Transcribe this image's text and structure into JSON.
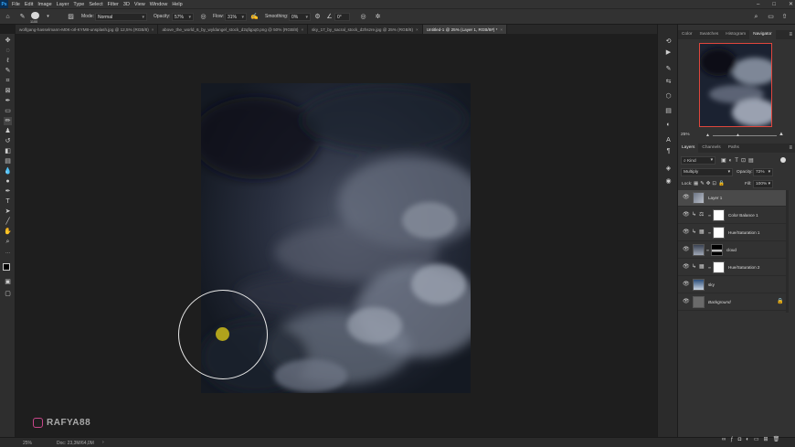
{
  "menu": {
    "app_icon": "Ps",
    "items": [
      "File",
      "Edit",
      "Image",
      "Layer",
      "Type",
      "Select",
      "Filter",
      "3D",
      "View",
      "Window",
      "Help"
    ]
  },
  "options": {
    "brush_size": "1100",
    "mode_label": "Mode:",
    "mode_value": "Normal",
    "opacity_label": "Opacity:",
    "opacity_value": "57%",
    "flow_label": "Flow:",
    "flow_value": "31%",
    "smoothing_label": "Smoothing:",
    "smoothing_value": "0%",
    "angle_value": "0°"
  },
  "tabs": [
    {
      "label": "wolfgang-hasselmann-M0K-oIl-KYM8-unsplash.jpg @ 12,5% (RGB/8)"
    },
    {
      "label": "above_the_world_6_by_wyldangel_stock_d2qfqpq0.png @ 50% (RGB/8)"
    },
    {
      "label": "sky_17_by_sacral_stock_d2hszre.jpg @ 25% (RGB/8)"
    },
    {
      "label": "Untitled-1 @ 25% (Layer 1, RGB/8#) *"
    }
  ],
  "active_tab_index": 3,
  "watermark": "RAFYA88",
  "status": {
    "zoom": "25%",
    "doc": "Doc: 23,3M/64,0M"
  },
  "navigator": {
    "tabs": [
      "Color",
      "Swatches",
      "Histogram",
      "Navigator"
    ],
    "active": "Navigator",
    "zoom": "25%"
  },
  "layers_panel": {
    "tabs": [
      "Layers",
      "Channels",
      "Paths"
    ],
    "active": "Layers",
    "filter_label": "Kind",
    "blend_mode": "Multiply",
    "opacity_label": "Opacity:",
    "opacity_value": "72%",
    "lock_label": "Lock:",
    "fill_label": "Fill:",
    "fill_value": "100%",
    "layers": [
      {
        "name": "Layer 1",
        "selected": true,
        "italic": false
      },
      {
        "name": "Color Balance 1",
        "selected": false,
        "italic": false
      },
      {
        "name": "Hue/Saturation 1",
        "selected": false,
        "italic": false
      },
      {
        "name": "cloud",
        "selected": false,
        "italic": false
      },
      {
        "name": "Hue/Saturation 2",
        "selected": false,
        "italic": false
      },
      {
        "name": "sky",
        "selected": false,
        "italic": false
      },
      {
        "name": "Background",
        "selected": false,
        "italic": true
      }
    ]
  },
  "colors": {
    "accent_navigator_frame": "#e0463c",
    "brush_dot": "#b0a31c",
    "panel_bg": "#323232",
    "app_bg": "#1e1e1e"
  }
}
